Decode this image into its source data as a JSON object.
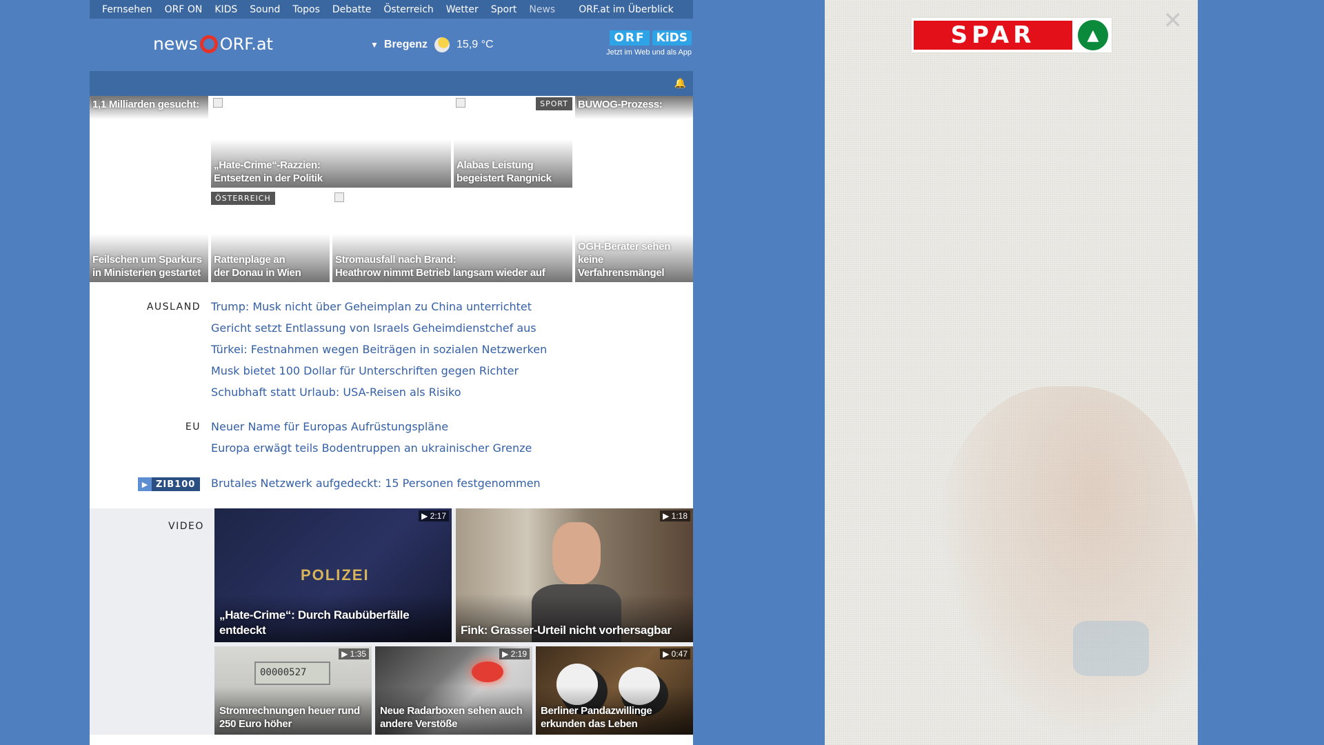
{
  "nav": {
    "items": [
      "Fernsehen",
      "ORF ON",
      "KIDS",
      "Sound",
      "Topos",
      "Debatte",
      "Österreich",
      "Wetter",
      "Sport",
      "News"
    ],
    "overview": "ORF.at im Überblick"
  },
  "header": {
    "logo_news": "news",
    "logo_orf": "ORF.at",
    "weather": {
      "city": "Bregenz",
      "temp": "15,9 °C"
    },
    "kids": {
      "badge1": "ORF",
      "badge2": "KiDS",
      "sub": "Jetzt im Web und als App"
    }
  },
  "tiles": {
    "t1_top": "1,1 Milliarden gesucht:",
    "t1_bottom": "Feilschen um Sparkurs\nin Ministerien gestartet",
    "t2": "„Hate-Crime“-Razzien:\nEntsetzen in der Politik",
    "t3_tag": "SPORT",
    "t3": "Alabas Leistung\nbegeistert Rangnick",
    "t4_top": "BUWOG-Prozess:",
    "t4_bottom": "OGH-Berater sehen\nkeine Verfahrensmängel",
    "t5_tag": "ÖSTERREICH",
    "t5": "Rattenplage an\nder Donau in Wien",
    "t6": "Stromausfall nach Brand:\nHeathrow nimmt Betrieb langsam wieder auf"
  },
  "ausland": {
    "label": "AUSLAND",
    "links": [
      "Trump: Musk nicht über Geheimplan zu China unterrichtet",
      "Gericht setzt Entlassung von Israels Geheimdienstchef aus",
      "Türkei: Festnahmen wegen Beiträgen in sozialen Netzwerken",
      "Musk bietet 100 Dollar für Unterschriften gegen Richter",
      "Schubhaft statt Urlaub: USA-Reisen als Risiko"
    ]
  },
  "eu": {
    "label": "EU",
    "links": [
      "Neuer Name für Europas Aufrüstungspläne",
      "Europa erwägt teils Bodentruppen an ukrainischer Grenze"
    ]
  },
  "zib": {
    "badge": "ZIB100",
    "link": "Brutales Netzwerk aufgedeckt: 15 Personen festgenommen"
  },
  "video": {
    "label": "VIDEO",
    "items": [
      {
        "duration": "2:17",
        "caption": "„Hate-Crime“: Durch Raubüberfälle entdeckt",
        "overlay": "POLIZEI"
      },
      {
        "duration": "1:18",
        "caption": "Fink: Grasser-Urteil nicht vorhersagbar"
      },
      {
        "duration": "1:35",
        "caption": "Stromrechnungen heuer rund 250 Euro höher",
        "overlay": "00000527"
      },
      {
        "duration": "2:19",
        "caption": "Neue Radarboxen sehen auch andere Verstöße"
      },
      {
        "duration": "0:47",
        "caption": "Berliner Pandazwillinge erkunden das Leben"
      }
    ]
  },
  "ad": {
    "brand": "SPAR",
    "close": "✕"
  },
  "colors": {
    "page_bg": "#4f7fbf",
    "nav_bg": "#3b67a0",
    "link": "#3560a6",
    "orf_red": "#e5332a"
  }
}
